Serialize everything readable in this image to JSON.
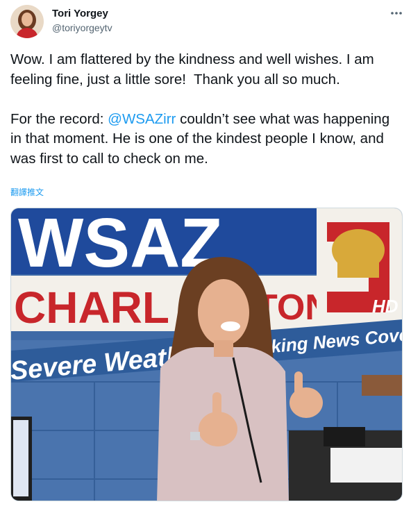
{
  "author": {
    "display_name": "Tori Yorgey",
    "handle": "@toriyorgeytv"
  },
  "tweet": {
    "text_part1": "Wow. I am flattered by the kindness and well wishes. I am feeling fine, just a little sore!  Thank you all so much.\n\nFor the record: ",
    "mention": "@WSAZirr",
    "text_part2": " couldn’t see what was happening in that moment. He is one of the kindest people I know, and was first to call to check on me.",
    "translate_label": "翻譯推文",
    "more_icon": "more-icon"
  },
  "photo": {
    "sign_wsaz": "WSAZ",
    "sign_charleston_left": "CHARL",
    "sign_charleston_right": "TON",
    "sign_hd": "HD",
    "banner_left": "Severe Weath",
    "banner_right": "king News Coverage",
    "colors": {
      "wall": "#3f6aa6",
      "sign_blue": "#1f4a9c",
      "sign_red": "#c8262b",
      "logo_gold": "#d8a93a"
    }
  }
}
